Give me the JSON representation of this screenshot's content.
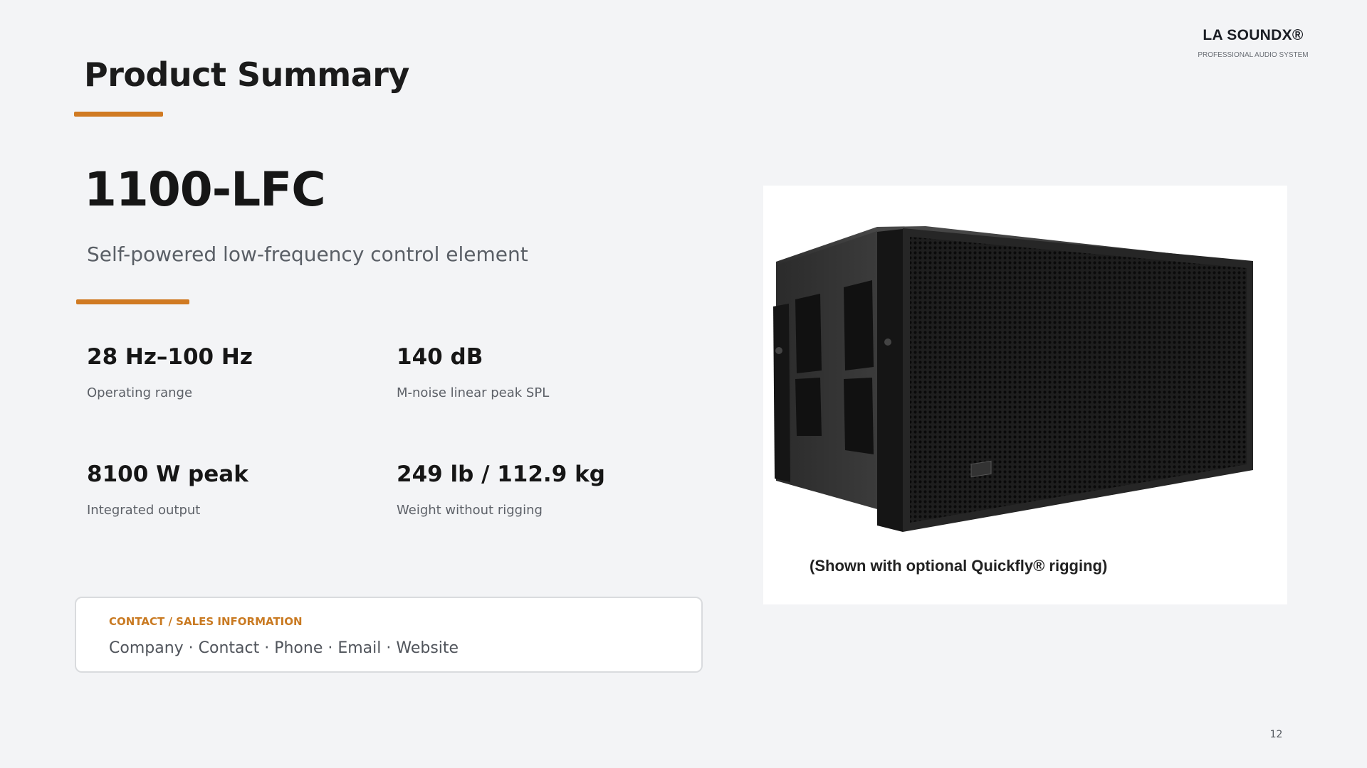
{
  "brand": {
    "name": "LA SOUNDX®",
    "tagline": "PROFESSIONAL AUDIO SYSTEM"
  },
  "page_title": "Product Summary",
  "product": {
    "name": "1100-LFC",
    "description": "Self-powered low-frequency control element"
  },
  "specs": [
    {
      "value": "28 Hz–100 Hz",
      "label": "Operating range"
    },
    {
      "value": "140 dB",
      "label": "M-noise linear peak SPL"
    },
    {
      "value": "8100 W peak",
      "label": "Integrated output"
    },
    {
      "value": "249 lb / 112.9 kg",
      "label": "Weight without rigging"
    }
  ],
  "contact": {
    "heading": "CONTACT / SALES INFORMATION",
    "details": "Company · Contact · Phone · Email · Website"
  },
  "image": {
    "caption": "(Shown with optional Quickfly® rigging)"
  },
  "page_number": "12",
  "colors": {
    "accent": "#d07a22",
    "background": "#f3f4f6",
    "text": "#1a1a1a"
  }
}
